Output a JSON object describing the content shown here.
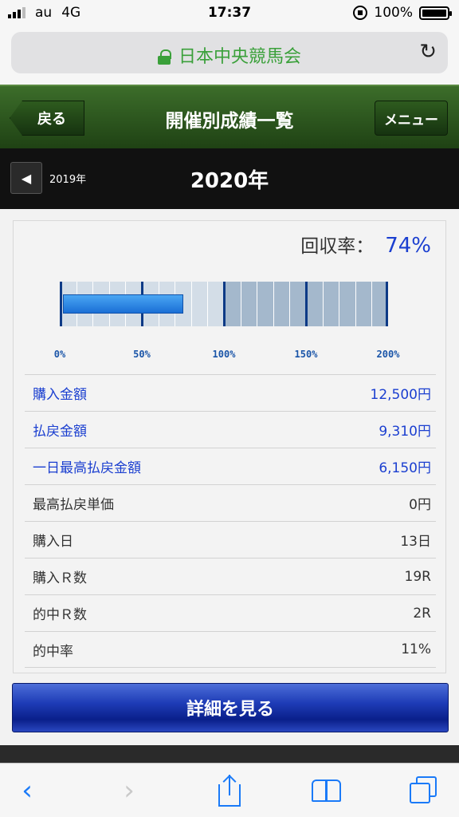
{
  "status_bar": {
    "carrier": "au",
    "network": "4G",
    "time": "17:37",
    "battery": "100%"
  },
  "browser": {
    "domain": "日本中央競馬会"
  },
  "header": {
    "back_label": "戻る",
    "title": "開催別成績一覧",
    "menu_label": "メニュー"
  },
  "year_nav": {
    "prev_year": "2019年",
    "current_year": "2020年"
  },
  "summary": {
    "rate_label": "回収率：",
    "rate_value": "74%",
    "gauge": {
      "fill_percent": 74,
      "max_percent": 200,
      "ticks": [
        "0%",
        "50%",
        "100%",
        "150%",
        "200%"
      ]
    },
    "rows": [
      {
        "label": "購入金額",
        "value": "12,500円",
        "link": true
      },
      {
        "label": "払戻金額",
        "value": "9,310円",
        "link": true
      },
      {
        "label": "一日最高払戻金額",
        "value": "6,150円",
        "link": true
      },
      {
        "label": "最高払戻単価",
        "value": "0円",
        "link": false
      },
      {
        "label": "購入日",
        "value": "13日",
        "link": false
      },
      {
        "label": "購入Ｒ数",
        "value": "19R",
        "link": false
      },
      {
        "label": "的中Ｒ数",
        "value": "2R",
        "link": false
      },
      {
        "label": "的中率",
        "value": "11%",
        "link": false
      }
    ]
  },
  "detail_button": {
    "label": "詳細を見る"
  },
  "colors": {
    "header_green": "#2d5a1e",
    "link_blue": "#1b3fd0",
    "gauge_fill": "#2a86e6",
    "button_navy": "#0a1f8a"
  },
  "toolbar": {
    "icons": [
      "chevron-left-icon",
      "chevron-right-icon",
      "share-icon",
      "bookmarks-icon",
      "tabs-icon"
    ]
  }
}
